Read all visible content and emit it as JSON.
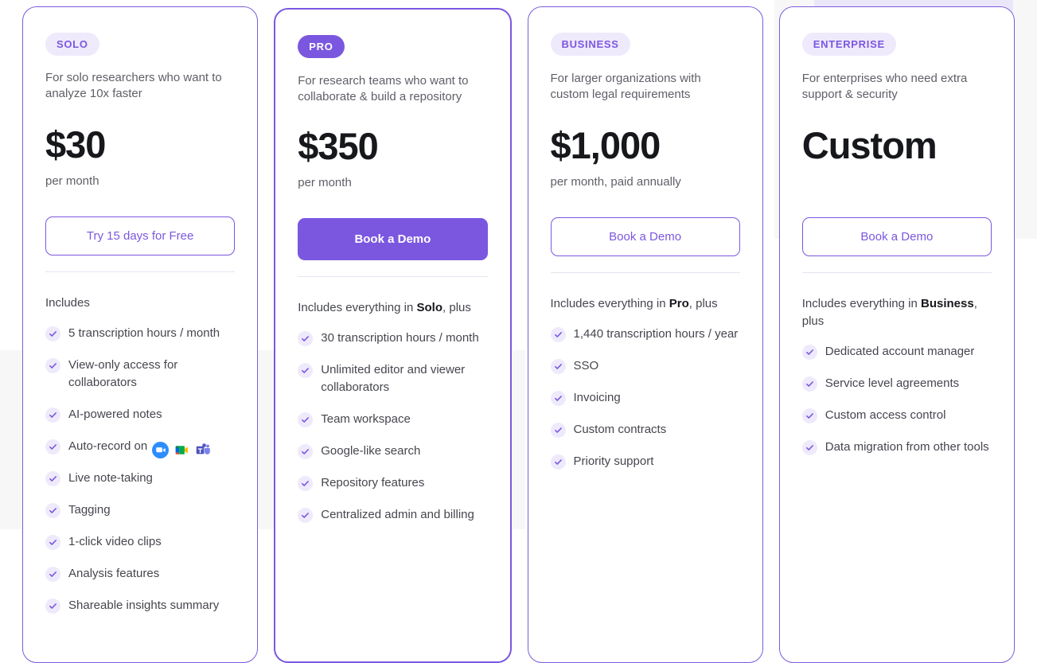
{
  "theme": {
    "accent": "#7b57e0",
    "accent_light": "#eeeafc",
    "text_dark": "#17181c",
    "text_muted": "#5f6068",
    "page_bg": "#ffffff",
    "panel_bg": "#f7f7f8"
  },
  "plans": [
    {
      "badge": "SOLO",
      "tagline": "For solo researchers who want to analyze 10x faster",
      "price": "$30",
      "period": "per month",
      "cta": "Try 15 days for Free",
      "cta_style": "outline",
      "includes_label": "Includes",
      "includes_prefix": "",
      "includes_bold": "",
      "includes_suffix": "",
      "features": [
        "5 transcription hours / month",
        "View-only access for collaborators",
        "AI-powered notes",
        "Auto-record on",
        "Live note-taking",
        "Tagging",
        "1-click video clips",
        "Analysis features",
        "Shareable insights summary"
      ],
      "app_icons": [
        "zoom-icon",
        "google-meet-icon",
        "microsoft-teams-icon"
      ]
    },
    {
      "badge": "PRO",
      "tagline": "For research teams who want to collaborate & build a repository",
      "price": "$350",
      "period": "per month",
      "cta": "Book a Demo",
      "cta_style": "filled",
      "includes_label": "",
      "includes_prefix": "Includes everything in ",
      "includes_bold": "Solo",
      "includes_suffix": ", plus",
      "features": [
        "30 transcription hours / month",
        "Unlimited editor and viewer collaborators",
        "Team workspace",
        "Google-like search",
        "Repository features",
        "Centralized admin and billing"
      ]
    },
    {
      "badge": "BUSINESS",
      "tagline": "For larger organizations with custom legal requirements",
      "price": "$1,000",
      "period": "per month, paid annually",
      "cta": "Book a Demo",
      "cta_style": "outline",
      "includes_label": "",
      "includes_prefix": "Includes everything in ",
      "includes_bold": "Pro",
      "includes_suffix": ", plus",
      "features": [
        "1,440 transcription hours / year",
        "SSO",
        "Invoicing",
        "Custom contracts",
        "Priority support"
      ]
    },
    {
      "badge": "ENTERPRISE",
      "tagline": "For enterprises who need extra support & security",
      "price": "Custom",
      "period": "",
      "cta": "Book a Demo",
      "cta_style": "outline",
      "includes_label": "",
      "includes_prefix": "Includes everything in ",
      "includes_bold": "Business",
      "includes_suffix": ", plus",
      "features": [
        "Dedicated account manager",
        "Service level agreements",
        "Custom access control",
        "Data migration from other tools"
      ]
    }
  ]
}
